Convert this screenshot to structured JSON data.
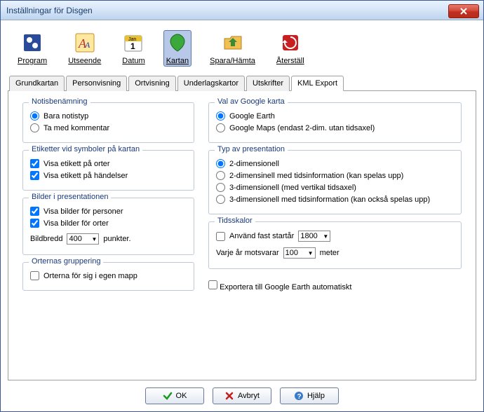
{
  "window": {
    "title": "Inställningar för Disgen"
  },
  "toolbar": {
    "program": "Program",
    "utseende": "Utseende",
    "datum": "Datum",
    "kartan": "Kartan",
    "spara_hamta": "Spara/Hämta",
    "aterstall": "Återställ"
  },
  "tabs": {
    "grundkartan": "Grundkartan",
    "personvisning": "Personvisning",
    "ortvisning": "Ortvisning",
    "underlagskartor": "Underlagskartor",
    "utskrifter": "Utskrifter",
    "kml_export": "KML Export"
  },
  "notisbenamning": {
    "title": "Notisbenämning",
    "bara_notistyp": "Bara notistyp",
    "ta_med_kommentar": "Ta med kommentar"
  },
  "etiketter": {
    "title": "Etiketter vid symboler på kartan",
    "orter": "Visa etikett på orter",
    "handelser": "Visa etikett på händelser"
  },
  "bilder": {
    "title": "Bilder i presentationen",
    "personer": "Visa bilder för personer",
    "orter": "Visa bilder för orter",
    "bildbredd_label": "Bildbredd",
    "bildbredd_value": "400",
    "punkter": "punkter."
  },
  "ortgrupp": {
    "title": "Orternas gruppering",
    "egen_mapp": "Orterna för sig i egen mapp"
  },
  "google_karta": {
    "title": "Val av Google karta",
    "earth": "Google Earth",
    "maps": "Google Maps (endast 2-dim. utan tidsaxel)"
  },
  "presentation": {
    "title": "Typ av presentation",
    "p2d": "2-dimensionell",
    "p2dt": "2-dimensinell med tidsinformation (kan spelas upp)",
    "p3d": "3-dimensionell (med vertikal tidsaxel)",
    "p3dt": "3-dimensionell med tidsinformation (kan också spelas upp)"
  },
  "tidsskalor": {
    "title": "Tidsskalor",
    "fast_startar": "Använd fast startår",
    "startar_value": "1800",
    "varje_ar": "Varje år motsvarar",
    "ar_value": "100",
    "meter": "meter"
  },
  "export_auto": "Exportera till Google Earth automatiskt",
  "buttons": {
    "ok": "OK",
    "avbryt": "Avbryt",
    "hjalp": "Hjälp"
  }
}
